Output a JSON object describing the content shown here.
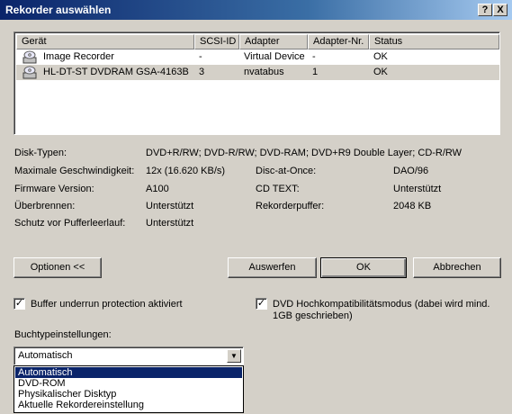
{
  "window": {
    "title": "Rekorder auswählen",
    "help_label": "?",
    "close_label": "X"
  },
  "list": {
    "columns": [
      "Gerät",
      "SCSI-ID",
      "Adapter",
      "Adapter-Nr.",
      "Status"
    ],
    "rows": [
      {
        "device": "Image Recorder",
        "scsi_id": "-",
        "adapter": "Virtual Device",
        "adapter_nr": "-",
        "status": "OK",
        "icon": "recorder-icon"
      },
      {
        "device": "HL-DT-ST DVDRAM GSA-4163B",
        "scsi_id": "3",
        "adapter": "nvatabus",
        "adapter_nr": "1",
        "status": "OK",
        "icon": "recorder-icon"
      }
    ]
  },
  "info": {
    "disk_types_label": "Disk-Typen:",
    "disk_types_value": "DVD+R/RW; DVD-R/RW; DVD-RAM; DVD+R9 Double Layer; CD-R/RW",
    "max_speed_label": "Maximale Geschwindigkeit:",
    "max_speed_value": "12x (16.620 KB/s)",
    "dao_label": "Disc-at-Once:",
    "dao_value": "DAO/96",
    "firmware_label": "Firmware Version:",
    "firmware_value": "A100",
    "cdtext_label": "CD TEXT:",
    "cdtext_value": "Unterstützt",
    "overburn_label": "Überbrennen:",
    "overburn_value": "Unterstützt",
    "buffer_label": "Rekorderpuffer:",
    "buffer_value": "2048 KB",
    "underrun_label": "Schutz vor Pufferleerlauf:",
    "underrun_value": "Unterstützt"
  },
  "buttons": {
    "options": "Optionen <<",
    "eject": "Auswerfen",
    "ok": "OK",
    "cancel": "Abbrechen"
  },
  "checkboxes": {
    "buffer_underrun": {
      "label": "Buffer underrun protection aktiviert",
      "checked": true,
      "mark": "✓"
    },
    "dvd_compat": {
      "label_line1": "DVD Hochkompatibilitätsmodus (dabei wird mind.",
      "label_line2": "1GB geschrieben)",
      "checked": true,
      "mark": "✓"
    }
  },
  "booktype": {
    "label": "Buchtypeinstellungen:",
    "selected": "Automatisch",
    "arrow": "▼",
    "options": [
      "Automatisch",
      "DVD-ROM",
      "Physikalischer Disktyp",
      "Aktuelle Rekordereinstellung"
    ]
  }
}
